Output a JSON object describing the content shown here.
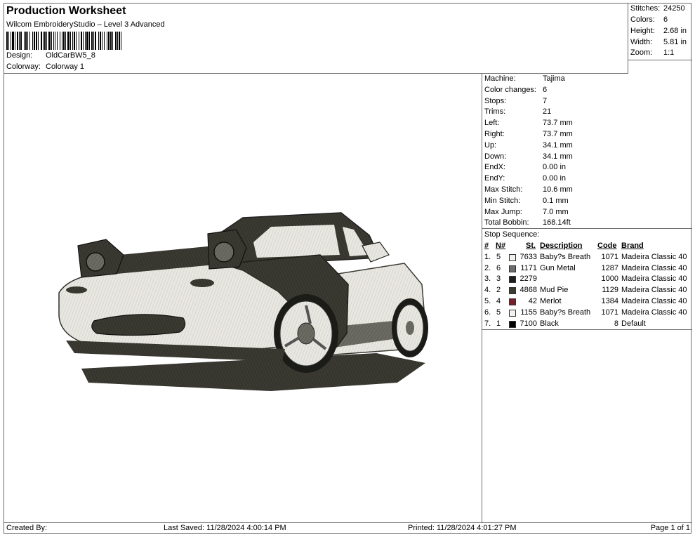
{
  "header": {
    "title": "Production Worksheet",
    "subtitle": "Wilcom EmbroideryStudio – Level 3 Advanced",
    "design_label": "Design:",
    "design_value": "OldCarBW5_8",
    "colorway_label": "Colorway:",
    "colorway_value": "Colorway 1"
  },
  "stats": [
    {
      "label": "Stitches:",
      "value": "24250"
    },
    {
      "label": "Colors:",
      "value": "6"
    },
    {
      "label": "Height:",
      "value": "2.68 in"
    },
    {
      "label": "Width:",
      "value": "5.81 in"
    },
    {
      "label": "Zoom:",
      "value": "1:1"
    }
  ],
  "machine_info": [
    {
      "label": "Machine:",
      "value": "Tajima"
    },
    {
      "label": "Color changes:",
      "value": "6"
    },
    {
      "label": "Stops:",
      "value": "7"
    },
    {
      "label": "Trims:",
      "value": "21"
    },
    {
      "label": "Left:",
      "value": "73.7 mm"
    },
    {
      "label": "Right:",
      "value": "73.7 mm"
    },
    {
      "label": "Up:",
      "value": "34.1 mm"
    },
    {
      "label": "Down:",
      "value": "34.1 mm"
    },
    {
      "label": "EndX:",
      "value": "0.00 in"
    },
    {
      "label": "EndY:",
      "value": "0.00 in"
    },
    {
      "label": "Max Stitch:",
      "value": "10.6 mm"
    },
    {
      "label": "Min Stitch:",
      "value": "0.1 mm"
    },
    {
      "label": "Max Jump:",
      "value": "7.0 mm"
    },
    {
      "label": "Total Bobbin:",
      "value": "168.14ft"
    }
  ],
  "stop_sequence": {
    "title": "Stop Sequence:",
    "columns": {
      "stop": "#",
      "needle": "N#",
      "stitches": "St.",
      "description": "Description",
      "code": "Code",
      "brand": "Brand"
    },
    "rows": [
      {
        "stop": "1.",
        "needle": "5",
        "color": "#f4f2ec",
        "stitches": "7633",
        "description": "Baby?s Breath",
        "code": "1071",
        "brand": "Madeira Classic 40"
      },
      {
        "stop": "2.",
        "needle": "6",
        "color": "#6c6c6a",
        "stitches": "1171",
        "description": "Gun Metal",
        "code": "1287",
        "brand": "Madeira Classic 40"
      },
      {
        "stop": "3.",
        "needle": "3",
        "color": "#1e1e1c",
        "stitches": "2279",
        "description": "",
        "code": "1000",
        "brand": "Madeira Classic 40"
      },
      {
        "stop": "4.",
        "needle": "2",
        "color": "#3a3a30",
        "stitches": "4868",
        "description": "Mud Pie",
        "code": "1129",
        "brand": "Madeira Classic 40"
      },
      {
        "stop": "5.",
        "needle": "4",
        "color": "#7a1f2a",
        "stitches": "42",
        "description": "Merlot",
        "code": "1384",
        "brand": "Madeira Classic 40"
      },
      {
        "stop": "6.",
        "needle": "5",
        "color": "#f4f2ec",
        "stitches": "1155",
        "description": "Baby?s Breath",
        "code": "1071",
        "brand": "Madeira Classic 40"
      },
      {
        "stop": "7.",
        "needle": "1",
        "color": "#000000",
        "stitches": "7100",
        "description": "Black",
        "code": "8",
        "brand": "Default"
      }
    ]
  },
  "footer": {
    "created_by": "Created By:",
    "last_saved": "Last Saved: 11/28/2024 4:00:14 PM",
    "printed": "Printed: 11/28/2024 4:01:27 PM",
    "page": "Page 1 of 1"
  }
}
